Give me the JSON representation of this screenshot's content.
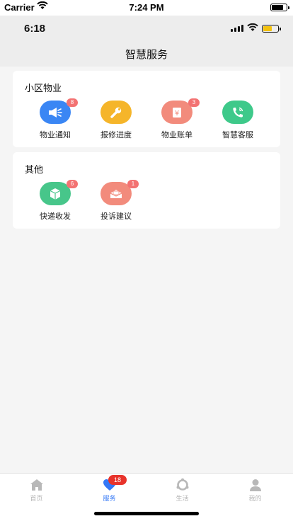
{
  "sim_status": {
    "carrier": "Carrier",
    "time": "7:24 PM"
  },
  "app_status": {
    "time": "6:18"
  },
  "header": {
    "title": "智慧服务"
  },
  "sections": [
    {
      "title": "小区物业",
      "items": [
        {
          "label": "物业通知",
          "badge": "8",
          "icon": "megaphone-icon",
          "color": "#3a86f4"
        },
        {
          "label": "报修进度",
          "badge": "",
          "icon": "wrench-icon",
          "color": "#f5b52a"
        },
        {
          "label": "物业账单",
          "badge": "3",
          "icon": "bill-icon",
          "color": "#f28b7c"
        },
        {
          "label": "智慧客服",
          "badge": "",
          "icon": "phone-icon",
          "color": "#3ec98a"
        }
      ]
    },
    {
      "title": "其他",
      "items": [
        {
          "label": "快递收发",
          "badge": "6",
          "icon": "package-icon",
          "color": "#47c68a"
        },
        {
          "label": "投诉建议",
          "badge": "1",
          "icon": "envelope-icon",
          "color": "#f28b7c"
        }
      ]
    }
  ],
  "tabbar": {
    "items": [
      {
        "label": "首页",
        "icon": "home-icon",
        "active": false
      },
      {
        "label": "服务",
        "icon": "service-icon",
        "active": true,
        "badge": "18"
      },
      {
        "label": "生活",
        "icon": "life-icon",
        "active": false
      },
      {
        "label": "我的",
        "icon": "profile-icon",
        "active": false
      }
    ]
  }
}
